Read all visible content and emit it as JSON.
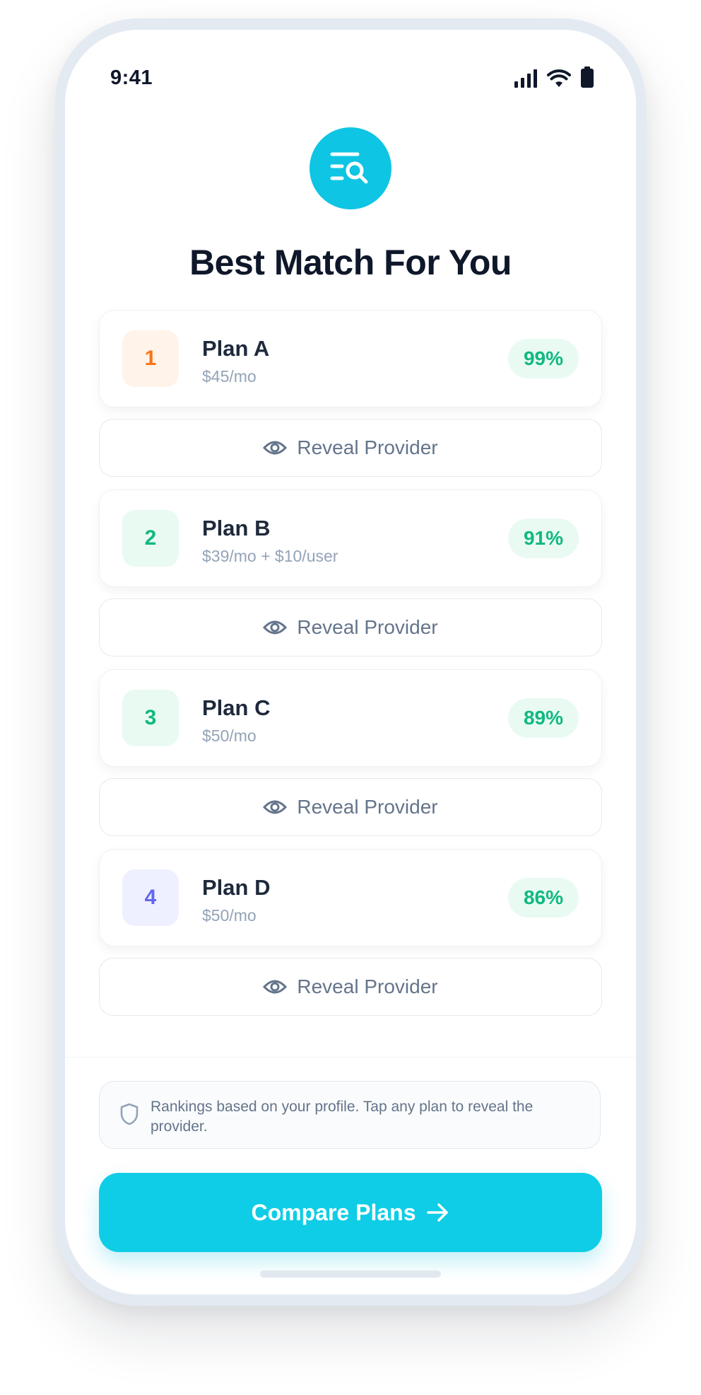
{
  "status_bar": {
    "time": "9:41"
  },
  "header": {
    "icon": "search-list-icon",
    "title": "Best Match For You"
  },
  "plans": [
    {
      "rank": "1",
      "name": "Plan A",
      "price": "$45/mo",
      "match": "99%",
      "rank_color": "#f97316",
      "rank_bg": "#fff3ea"
    },
    {
      "rank": "2",
      "name": "Plan B",
      "price": "$39/mo + $10/user",
      "match": "91%",
      "rank_color": "#10b981",
      "rank_bg": "#e9faf2"
    },
    {
      "rank": "3",
      "name": "Plan C",
      "price": "$50/mo",
      "match": "89%",
      "rank_color": "#10b981",
      "rank_bg": "#e9faf2"
    },
    {
      "rank": "4",
      "name": "Plan D",
      "price": "$50/mo",
      "match": "86%",
      "rank_color": "#6366f1",
      "rank_bg": "#eef0ff"
    }
  ],
  "reveal_label": "Reveal Provider",
  "info": {
    "icon": "shield-icon",
    "text": "Rankings based on your profile. Tap any plan to reveal the provider."
  },
  "cta": {
    "label": "Compare Plans",
    "icon": "arrow-right-icon"
  },
  "colors": {
    "accent": "#0ec5e3",
    "match_green": "#10b981",
    "title": "#0f172a"
  }
}
